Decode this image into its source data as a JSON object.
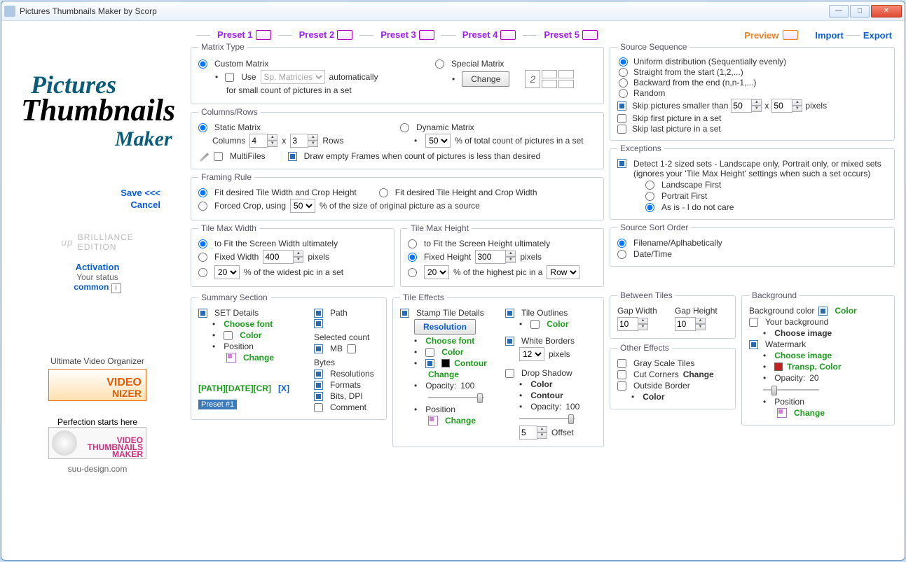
{
  "window": {
    "title": "Pictures Thumbnails Maker by Scorp"
  },
  "logo": {
    "l1": "Pictures",
    "l2": "Thumbnails",
    "l3": "Maker"
  },
  "left": {
    "save": "Save <<<",
    "cancel": "Cancel",
    "brilliance": "BRILLIANCE",
    "edition": "EDITION",
    "up": "up",
    "activation": "Activation",
    "yourstatus": "Your status",
    "common": "common",
    "promo1cap": "Ultimate Video Organizer",
    "promo1a": "VIDEO",
    "promo1b": "NIZER",
    "promo2cap": "Perfection starts here",
    "promo2a": "VIDEO",
    "promo2b": "THUMBNAILS",
    "promo2c": "MAKER",
    "suu": "suu-design.com"
  },
  "tabs": {
    "p1": "Preset 1",
    "p2": "Preset 2",
    "p3": "Preset 3",
    "p4": "Preset 4",
    "p5": "Preset 5",
    "preview": "Preview",
    "import": "Import",
    "export": "Export"
  },
  "matrix": {
    "legend": "Matrix Type",
    "custom": "Custom Matrix",
    "special": "Special Matrix",
    "use": "Use",
    "sp": "Sp. Matricies",
    "auto": "automatically",
    "forsmall": "for small count of pictures in a set",
    "change": "Change",
    "gridnum": "2"
  },
  "colrows": {
    "legend": "Columns/Rows",
    "static": "Static Matrix",
    "dynamic": "Dynamic Matrix",
    "columns": "Columns",
    "colval": "4",
    "x": "x",
    "rowval": "3",
    "rows": "Rows",
    "pct": "50",
    "pcttxt": "% of total count of pictures in a set",
    "multi": "MultiFiles",
    "drawempty": "Draw empty Frames when count of pictures is less than desired"
  },
  "frule": {
    "legend": "Framing Rule",
    "fitw": "Fit desired Tile Width and Crop Height",
    "fith": "Fit desired Tile Height and Crop Width",
    "forced": "Forced Crop, using",
    "fpct": "50",
    "ftxt": "% of the size of original picture as a source"
  },
  "tmw": {
    "legend": "Tile Max Width",
    "fit": "to Fit the Screen Width ultimately",
    "fixed": "Fixed Width",
    "fval": "400",
    "px": "pixels",
    "pct": "20",
    "ptxt": "% of the widest pic in a set"
  },
  "tmh": {
    "legend": "Tile Max Height",
    "fit": "to Fit the Screen Height ultimately",
    "fixed": "Fixed Height",
    "fval": "300",
    "px": "pixels",
    "pct": "20",
    "ptxt": "% of the highest pic in a",
    "row": "Row"
  },
  "summary": {
    "legend": "Summary Section",
    "set": "SET Details",
    "choosefont": "Choose font",
    "color": "Color",
    "position": "Position",
    "change": "Change",
    "path": "Path",
    "selcount": "Selected count",
    "mb": "MB",
    "bytes": "Bytes",
    "res": "Resolutions",
    "formats": "Formats",
    "bits": "Bits, DPI",
    "comment": "Comment",
    "pathline": "[PATH][DATE][CR]",
    "x": "[X]",
    "preset": "Preset #1"
  },
  "teff": {
    "legend": "Tile Effects",
    "stamp": "Stamp Tile Details",
    "resolution": "Resolution",
    "choosefont": "Choose font",
    "color": "Color",
    "contour": "Contour",
    "change": "Change",
    "opacity": "Opacity:",
    "opval": "100",
    "position": "Position",
    "outlines": "Tile Outlines",
    "white": "White Borders",
    "wval": "12",
    "px": "pixels",
    "drop": "Drop Shadow",
    "offset": "Offset",
    "offval": "5"
  },
  "seq": {
    "legend": "Source Sequence",
    "uniform": "Uniform distribution (Sequentially evenly)",
    "straight": "Straight from the start (1,2,...)",
    "backward": "Backward from the end (n,n-1,...)",
    "random": "Random",
    "skips": "Skip pictures smaller than",
    "sw": "50",
    "sh": "50",
    "px": "pixels",
    "skipfirst": "Skip first picture in a set",
    "skiplast": "Skip last picture in a set",
    "x": "x"
  },
  "exc": {
    "legend": "Exceptions",
    "desc": "Detect 1-2 sized sets - Landscape only, Portrait only, or mixed sets (ignores your 'Tile Max Height' settings when such a set occurs)",
    "lf": "Landscape First",
    "pf": "Portrait First",
    "asis": "As is - I do not care"
  },
  "sort": {
    "legend": "Source Sort Order",
    "fn": "Filename/Aplhabetically",
    "dt": "Date/Time"
  },
  "bt": {
    "legend": "Between Tiles",
    "gw": "Gap Width",
    "gh": "Gap Height",
    "gwv": "10",
    "ghv": "10"
  },
  "oe": {
    "legend": "Other Effects",
    "gs": "Gray Scale Tiles",
    "cc": "Cut Corners",
    "change": "Change",
    "ob": "Outside Border",
    "color": "Color"
  },
  "bg": {
    "legend": "Background",
    "bgc": "Background color",
    "color": "Color",
    "yb": "Your background",
    "ci": "Choose image",
    "wm": "Watermark",
    "tc": "Transp. Color",
    "opacity": "Opacity:",
    "opval": "20",
    "position": "Position",
    "change": "Change"
  }
}
